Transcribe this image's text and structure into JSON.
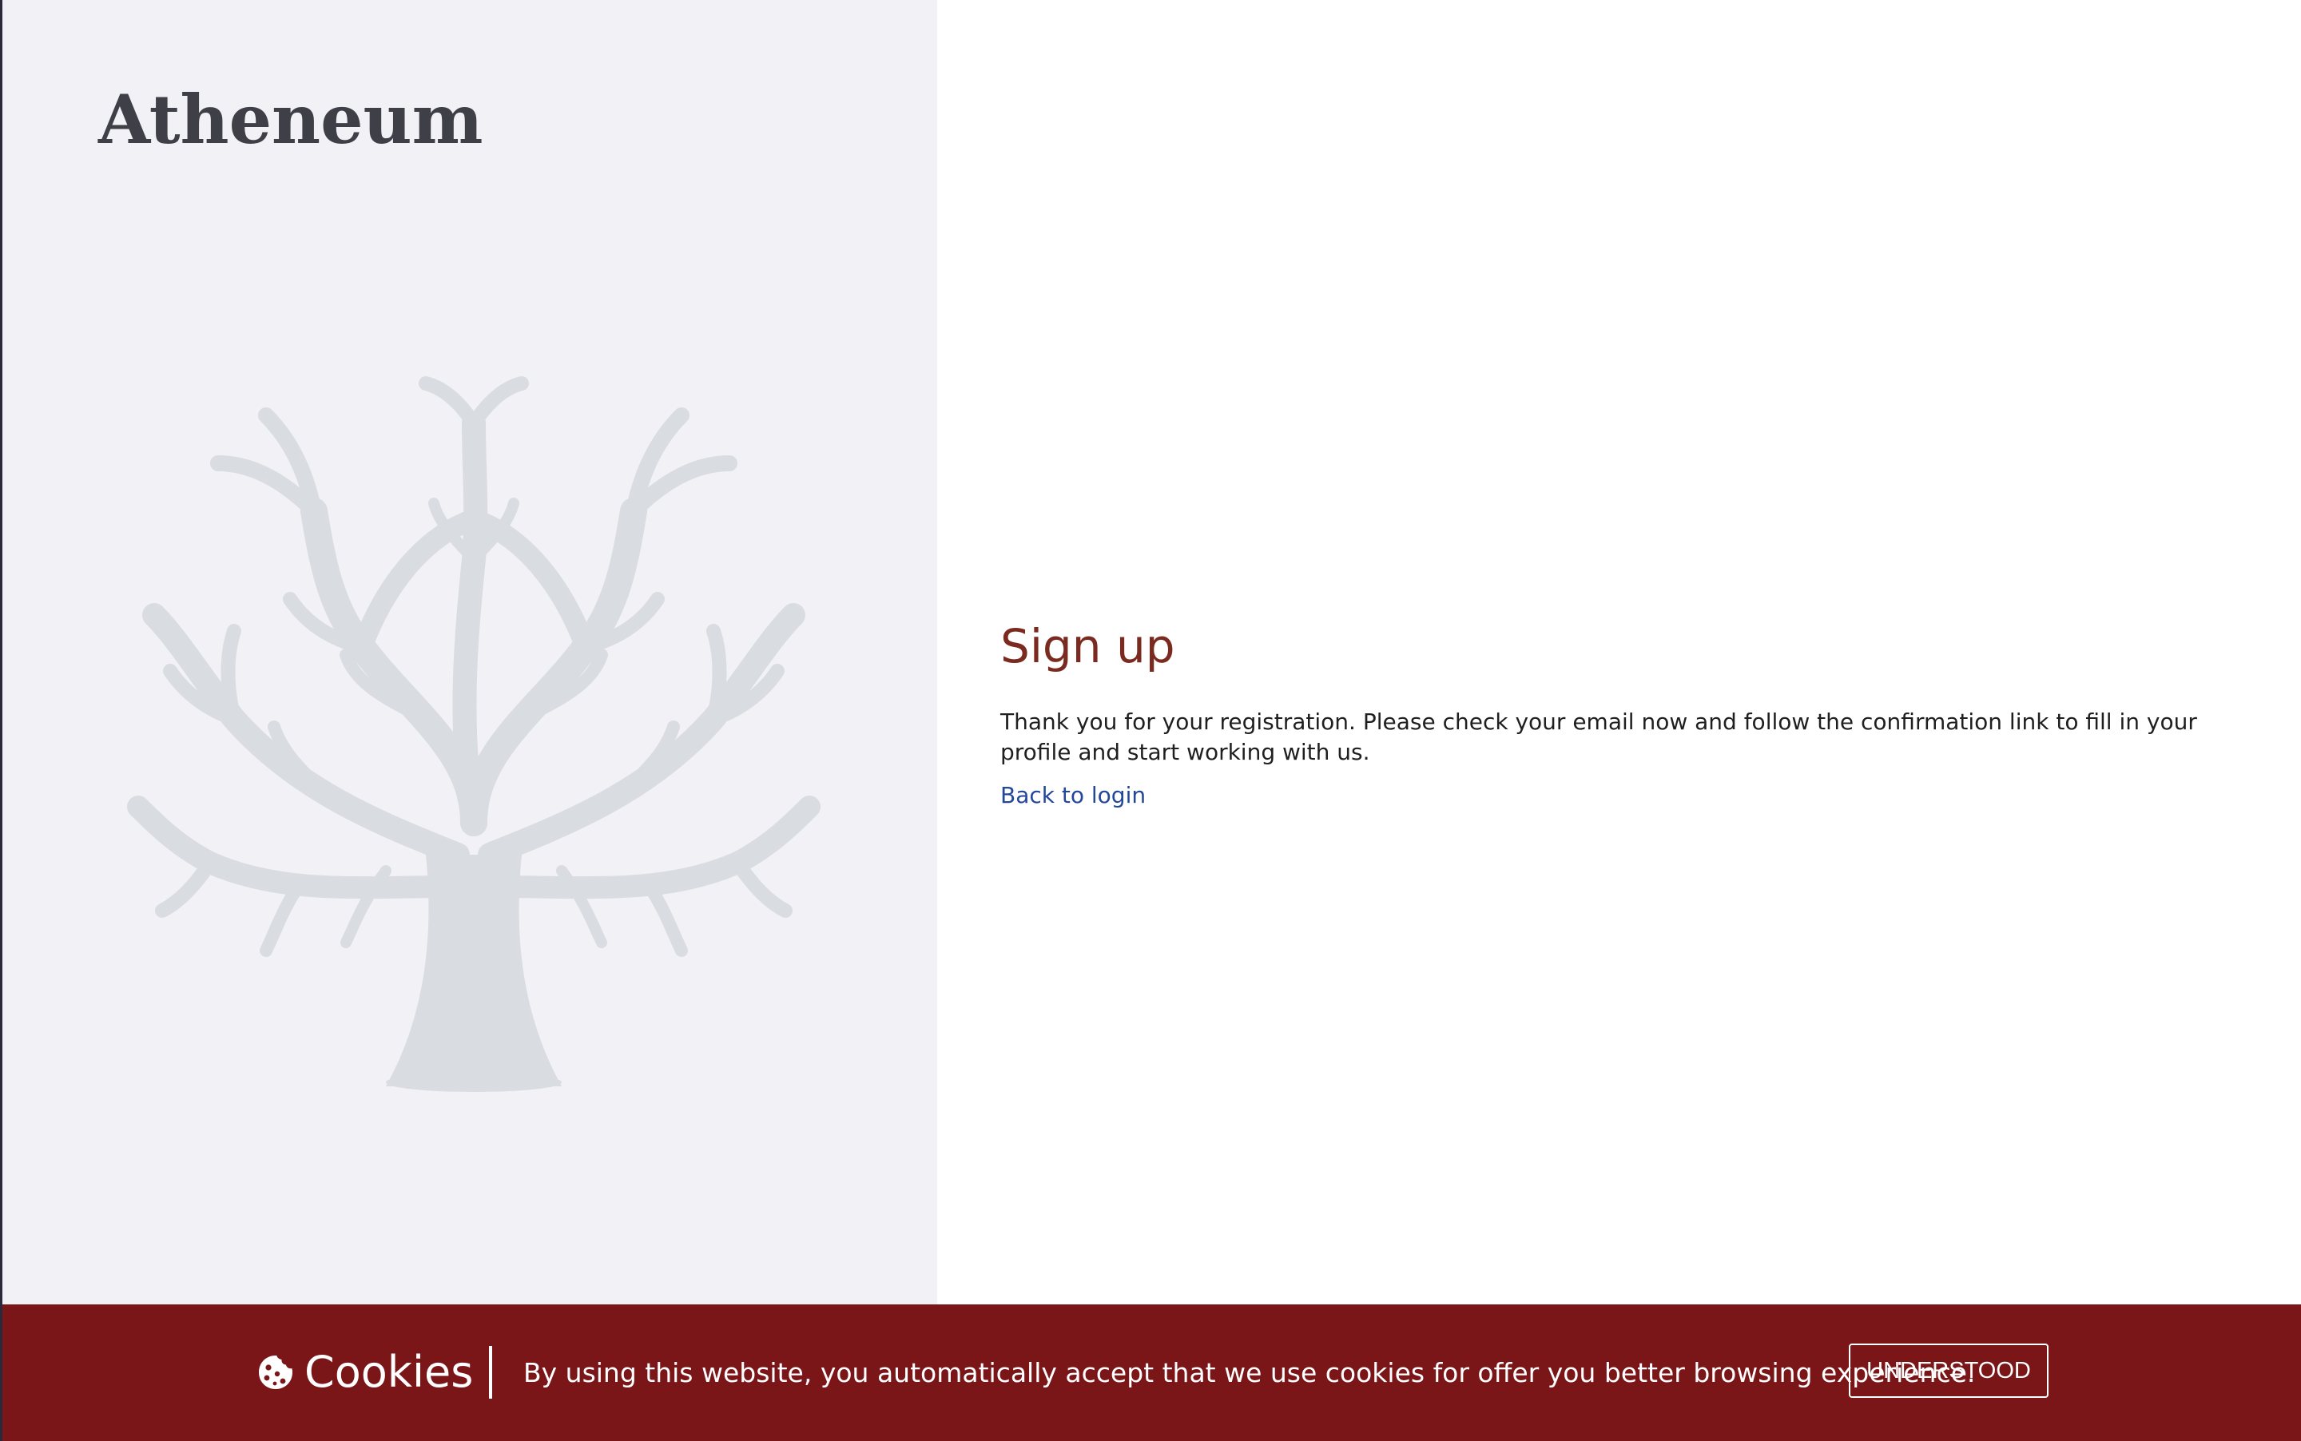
{
  "brand": {
    "logo_text": "Atheneum"
  },
  "main": {
    "heading": "Sign up",
    "message": "Thank you for your registration. Please check your email now and follow the confirmation link to fill in your profile and start working with us.",
    "back_link": "Back to login"
  },
  "cookie_banner": {
    "icon": "cookie-icon",
    "title": "Cookies",
    "text": "By using this website, you automatically accept that we use cookies for offer you better browsing experience.",
    "button_label": "UNDERSTOOD"
  },
  "colors": {
    "heading": "#7a2a1e",
    "link": "#23479a",
    "cookie_bar_bg": "#7a1518",
    "left_panel_bg": "#f1f1f6",
    "tree": "#d9dce1",
    "logo": "#3f3f47"
  }
}
